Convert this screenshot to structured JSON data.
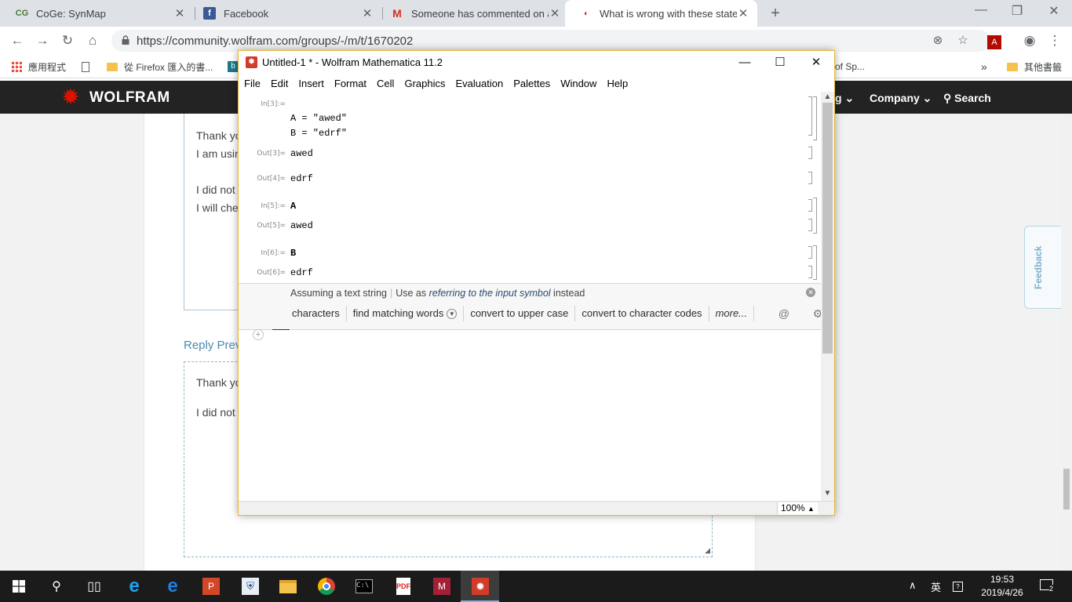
{
  "browser": {
    "tabs": [
      {
        "title": "CoGe: SynMap",
        "icon": "coge-icon"
      },
      {
        "title": "Facebook",
        "icon": "facebook-icon"
      },
      {
        "title": "Someone has commented on a",
        "icon": "gmail-icon"
      },
      {
        "title": "What is wrong with these state",
        "icon": "wolfram-community-icon",
        "active": true
      }
    ],
    "url": "https://community.wolfram.com/groups/-/m/t/1670202",
    "bookmarks": {
      "apps": "應用程式",
      "firefox": "從 Firefox 匯入的書...",
      "partial": "of Sp...",
      "more": "»",
      "other": "其他書籤"
    }
  },
  "site": {
    "logo": "WOLFRAM",
    "nav": {
      "partial": "g",
      "company": "Company",
      "search": "Search"
    },
    "reply1": {
      "line1": "Thank yo",
      "line2": "I am usin",
      "line3": "I did not",
      "line4": "I will che"
    },
    "reply_preview_label": "Reply Prev",
    "reply2": {
      "line1": "Thank yo",
      "line2": "I did not"
    },
    "feedback": "Feedback"
  },
  "mathematica": {
    "title": "Untitled-1 * - Wolfram Mathematica 11.2",
    "menu": [
      "File",
      "Edit",
      "Insert",
      "Format",
      "Cell",
      "Graphics",
      "Evaluation",
      "Palettes",
      "Window",
      "Help"
    ],
    "cells": {
      "in3_label": "In[3]:=",
      "in3_line1": "A = \"awed\"",
      "in3_line2": "B = \"edrf\"",
      "out3_label": "Out[3]=",
      "out3_value": "awed",
      "out4_label": "Out[4]=",
      "out4_value": "edrf",
      "in5_label": "In[5]:=",
      "in5_value": "A",
      "out5_label": "Out[5]=",
      "out5_value": "awed",
      "in6_label": "In[6]:=",
      "in6_value": "B",
      "out6_label": "Out[6]=",
      "out6_value": "edrf"
    },
    "suggestions": {
      "assuming": "Assuming a text string",
      "use_as": "Use as",
      "referring": "referring to the input symbol",
      "instead": "instead",
      "buttons": [
        "characters",
        "find matching words",
        "convert to upper case",
        "convert to character codes",
        "more..."
      ]
    },
    "zoom": "100%"
  },
  "taskbar": {
    "ime": "英",
    "time": "19:53",
    "date": "2019/4/26",
    "notifications": "2"
  }
}
